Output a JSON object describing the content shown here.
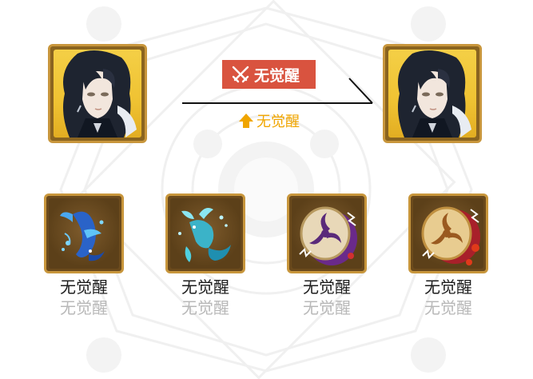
{
  "banner": {
    "label": "无觉醒",
    "icon": "crossed-swords-icon",
    "color": "#d9533f"
  },
  "upgrade": {
    "label": "无觉醒",
    "icon": "up-arrow-icon",
    "color": "#f0a500"
  },
  "portraits": {
    "before": {
      "icon": "character-portrait-icon"
    },
    "after": {
      "icon": "character-portrait-icon"
    }
  },
  "items": [
    {
      "icon": "blue-koi-fish-icon",
      "label": "无觉醒",
      "sublabel": "无觉醒"
    },
    {
      "icon": "cyan-goldfish-icon",
      "label": "无觉醒",
      "sublabel": "无觉醒"
    },
    {
      "icon": "purple-tomoe-drum-icon",
      "label": "无觉醒",
      "sublabel": "无觉醒"
    },
    {
      "icon": "red-tomoe-drum-icon",
      "label": "无觉醒",
      "sublabel": "无觉醒"
    }
  ]
}
